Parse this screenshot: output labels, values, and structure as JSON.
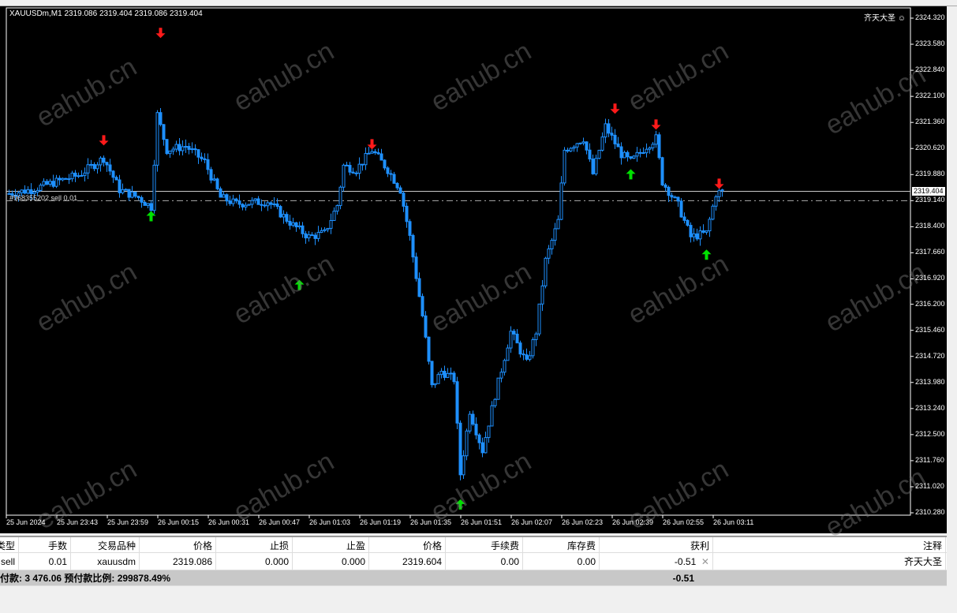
{
  "chart": {
    "title": "XAUUSDm,M1  2319.086 2319.404 2319.086 2319.404",
    "brand": "齐天大圣",
    "current_price": "2319.404",
    "order_line_price": "2319.140",
    "order_label": "#968355202 sell 0.01",
    "watermark": "eahub.cn",
    "colors": {
      "candle": "#1e90ff",
      "up_arrow": "#00e000",
      "down_arrow": "#ff1a1a",
      "bg": "#000000"
    }
  },
  "chart_data": {
    "type": "candlestick",
    "symbol": "XAUUSDm",
    "timeframe": "M1",
    "ylim": [
      2310.28,
      2324.32
    ],
    "y_ticks": [
      "2324.320",
      "2323.580",
      "2322.840",
      "2322.100",
      "2321.360",
      "2320.620",
      "2319.880",
      "2319.140",
      "2318.400",
      "2317.660",
      "2316.920",
      "2316.200",
      "2315.460",
      "2314.720",
      "2313.980",
      "2313.240",
      "2312.500",
      "2311.760",
      "2311.020",
      "2310.280"
    ],
    "x_ticks": [
      "25 Jun 2024",
      "25 Jun 23:43",
      "25 Jun 23:59",
      "26 Jun 00:15",
      "26 Jun 00:31",
      "26 Jun 00:47",
      "26 Jun 01:03",
      "26 Jun 01:19",
      "26 Jun 01:35",
      "26 Jun 01:51",
      "26 Jun 02:07",
      "26 Jun 02:23",
      "26 Jun 02:39",
      "26 Jun 02:55",
      "26 Jun 03:11"
    ],
    "bars_per_tick": 16,
    "price_path": [
      [
        0,
        2319.34
      ],
      [
        7,
        2319.45
      ],
      [
        15,
        2319.68
      ],
      [
        22,
        2319.86
      ],
      [
        30,
        2320.35
      ],
      [
        35,
        2319.45
      ],
      [
        41,
        2319.23
      ],
      [
        45,
        2318.96
      ],
      [
        47,
        2321.58
      ],
      [
        50,
        2320.58
      ],
      [
        56,
        2320.69
      ],
      [
        62,
        2320.24
      ],
      [
        67,
        2319.23
      ],
      [
        72,
        2319.05
      ],
      [
        82,
        2319.12
      ],
      [
        90,
        2318.44
      ],
      [
        95,
        2318.11
      ],
      [
        100,
        2318.22
      ],
      [
        104,
        2319.01
      ],
      [
        106,
        2320.13
      ],
      [
        110,
        2320.02
      ],
      [
        115,
        2320.58
      ],
      [
        120,
        2320.02
      ],
      [
        124,
        2319.45
      ],
      [
        127,
        2318.11
      ],
      [
        131,
        2315.87
      ],
      [
        134,
        2313.85
      ],
      [
        137,
        2314.3
      ],
      [
        141,
        2314.07
      ],
      [
        143,
        2311.38
      ],
      [
        146,
        2313.18
      ],
      [
        150,
        2312.05
      ],
      [
        154,
        2313.62
      ],
      [
        159,
        2315.42
      ],
      [
        164,
        2314.52
      ],
      [
        167,
        2315.42
      ],
      [
        170,
        2317.44
      ],
      [
        174,
        2318.56
      ],
      [
        176,
        2320.58
      ],
      [
        182,
        2320.91
      ],
      [
        185,
        2319.9
      ],
      [
        189,
        2321.25
      ],
      [
        194,
        2320.46
      ],
      [
        197,
        2320.24
      ],
      [
        202,
        2320.69
      ],
      [
        205,
        2320.91
      ],
      [
        207,
        2319.68
      ],
      [
        212,
        2319.01
      ],
      [
        216,
        2318.11
      ],
      [
        221,
        2318.22
      ],
      [
        224,
        2319.34
      ],
      [
        226,
        2319.4
      ]
    ],
    "signals": [
      {
        "bar": 30,
        "price": 2320.84,
        "dir": "down"
      },
      {
        "bar": 48,
        "price": 2323.89,
        "dir": "down"
      },
      {
        "bar": 115,
        "price": 2320.73,
        "dir": "down"
      },
      {
        "bar": 192,
        "price": 2321.74,
        "dir": "down"
      },
      {
        "bar": 205,
        "price": 2321.29,
        "dir": "down"
      },
      {
        "bar": 225,
        "price": 2319.61,
        "dir": "down"
      },
      {
        "bar": 45,
        "price": 2318.71,
        "dir": "up"
      },
      {
        "bar": 92,
        "price": 2316.76,
        "dir": "up"
      },
      {
        "bar": 143,
        "price": 2310.53,
        "dir": "up"
      },
      {
        "bar": 197,
        "price": 2319.9,
        "dir": "up"
      },
      {
        "bar": 221,
        "price": 2317.62,
        "dir": "up"
      }
    ]
  },
  "table": {
    "headers": [
      "类型",
      "手数",
      "交易品种",
      "价格",
      "止损",
      "止盈",
      "价格",
      "手续费",
      "库存费",
      "获利",
      "注释"
    ],
    "rows": [
      [
        "sell",
        "0.01",
        "xauusdm",
        "2319.086",
        "0.000",
        "0.000",
        "2319.604",
        "0.00",
        "0.00",
        "-0.51",
        "齐天大圣"
      ]
    ],
    "summary": "付款: 3 476.06  预付款比例: 299878.49%",
    "summary_profit": "-0.51"
  }
}
